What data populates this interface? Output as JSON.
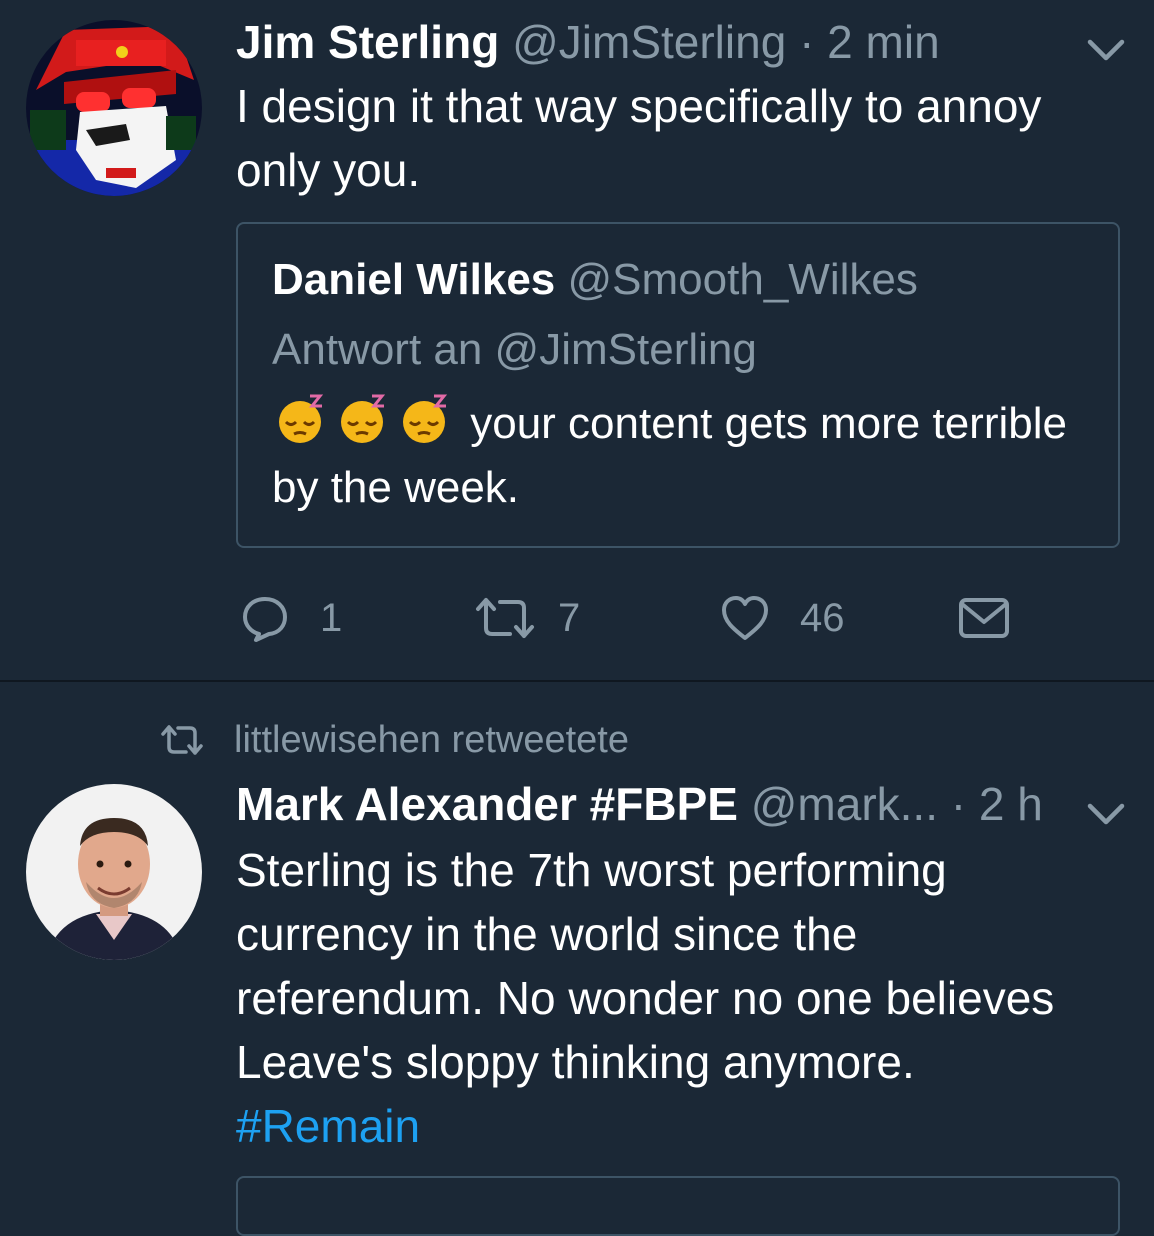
{
  "tweet1": {
    "name": "Jim Sterling",
    "handle": "@JimSterling",
    "separator": "·",
    "time": "2 min",
    "text": "I design it that way specifically to annoy only you.",
    "avatar_icon": "skull-hat-avatar-icon",
    "menu_icon": "chevron-down-icon",
    "quote": {
      "name": "Daniel Wilkes",
      "handle": "@Smooth_Wilkes",
      "reply_to": "Antwort an @JimSterling",
      "emoji_icon": "sleeping-face-emoji-icon",
      "emoji_count": 3,
      "text": "your content gets more terrible by the week."
    },
    "actions": {
      "reply_count": "1",
      "retweet_count": "7",
      "like_count": "46",
      "reply_icon": "reply-bubble-icon",
      "retweet_icon": "retweet-icon",
      "like_icon": "heart-icon",
      "dm_icon": "envelope-icon"
    }
  },
  "tweet2": {
    "retweeted_by": "littlewisehen retweetete",
    "retweet_icon": "retweet-icon",
    "name": "Mark Alexander #FBPE",
    "handle": "@mark...",
    "separator": "·",
    "time": "2 h",
    "text": "Sterling is the 7th worst performing currency in the world since the referendum. No wonder no one believes Leave's sloppy thinking anymore.",
    "hashtag": "#Remain",
    "avatar_icon": "man-portrait-avatar-icon",
    "menu_icon": "chevron-down-icon"
  },
  "colors": {
    "background": "#1b2836",
    "text": "#ffffff",
    "muted": "#8899a6",
    "link": "#1da1f2",
    "border": "#3d5466"
  }
}
